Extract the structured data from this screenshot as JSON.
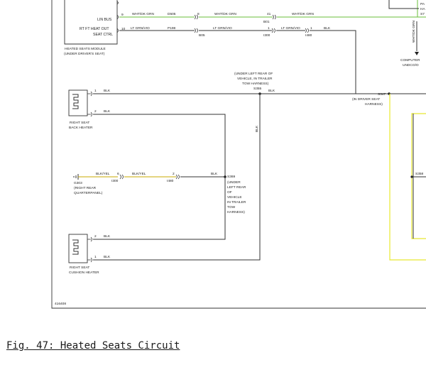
{
  "caption": "Fig. 47: Heated Seats Circuit",
  "module": {
    "name_line1": "HEATED SEATS MODULE",
    "name_line2": "(UNDER DRIVER'S SEAT)",
    "pin1_label": "LIN BUS",
    "pin2_label_line1": "RT FT HEAT OUT",
    "pin2_label_line2": "SEAT CTRL"
  },
  "wires": {
    "pin9": "9",
    "pin10": "10",
    "wht_dkgrn": "WHT/DK GRN",
    "lt_grn_vio": "LT GRN/VIO",
    "d505": "D505",
    "p198": "P198",
    "c8": "8",
    "b05": "B05",
    "c41": "41",
    "b01": "B01",
    "c1a": "1",
    "i300": "I300",
    "c1b": "1",
    "i480a": "I480",
    "blk": "BLK",
    "blk_yel": "BLK/YEL",
    "c6": "6",
    "i300b": "I300",
    "c2": "2",
    "i480b": "I480"
  },
  "splices": {
    "s355": "S355",
    "s355_note1": "(UNDER LEFT REAR OF",
    "s355_note2": "VEHICLE, IN TRAILER",
    "s355_note3": "TOW HARNESS)",
    "s347": "S347",
    "s347_note1": "(IN DRIVER SEAT",
    "s347_note2": "HARNESS)",
    "s369": "S369",
    "s369_note": [
      "(UNDER",
      "LEFT REAR",
      "OF",
      "VEHICLE",
      "IN TRAILER",
      "TOW",
      "HARNESS)"
    ],
    "s358": "S358"
  },
  "ground": {
    "name": "G303",
    "note1": "(RIGHT REAR",
    "note2": "QUARTERPANEL)"
  },
  "back_heater": {
    "label1": "RIGHT SEAT",
    "label2": "BACK HEATER",
    "pin1": "1",
    "pin2": "2"
  },
  "cushion_heater": {
    "label1": "RIGHT SEAT",
    "label2": "CUSHION HEATER",
    "pin1": "1",
    "pin2": "2"
  },
  "right_side": {
    "frag1": "PA",
    "frag2": "HA",
    "frag3": "S7",
    "vertical_wire": "WHT/DK GRN",
    "computer1": "COMPUTER",
    "computer2": "UNDCO/O"
  },
  "diagram_id": "416408",
  "colors": {
    "green_wire": "#6abf3a",
    "yellow_wire": "#e8e830",
    "black": "#333333"
  }
}
